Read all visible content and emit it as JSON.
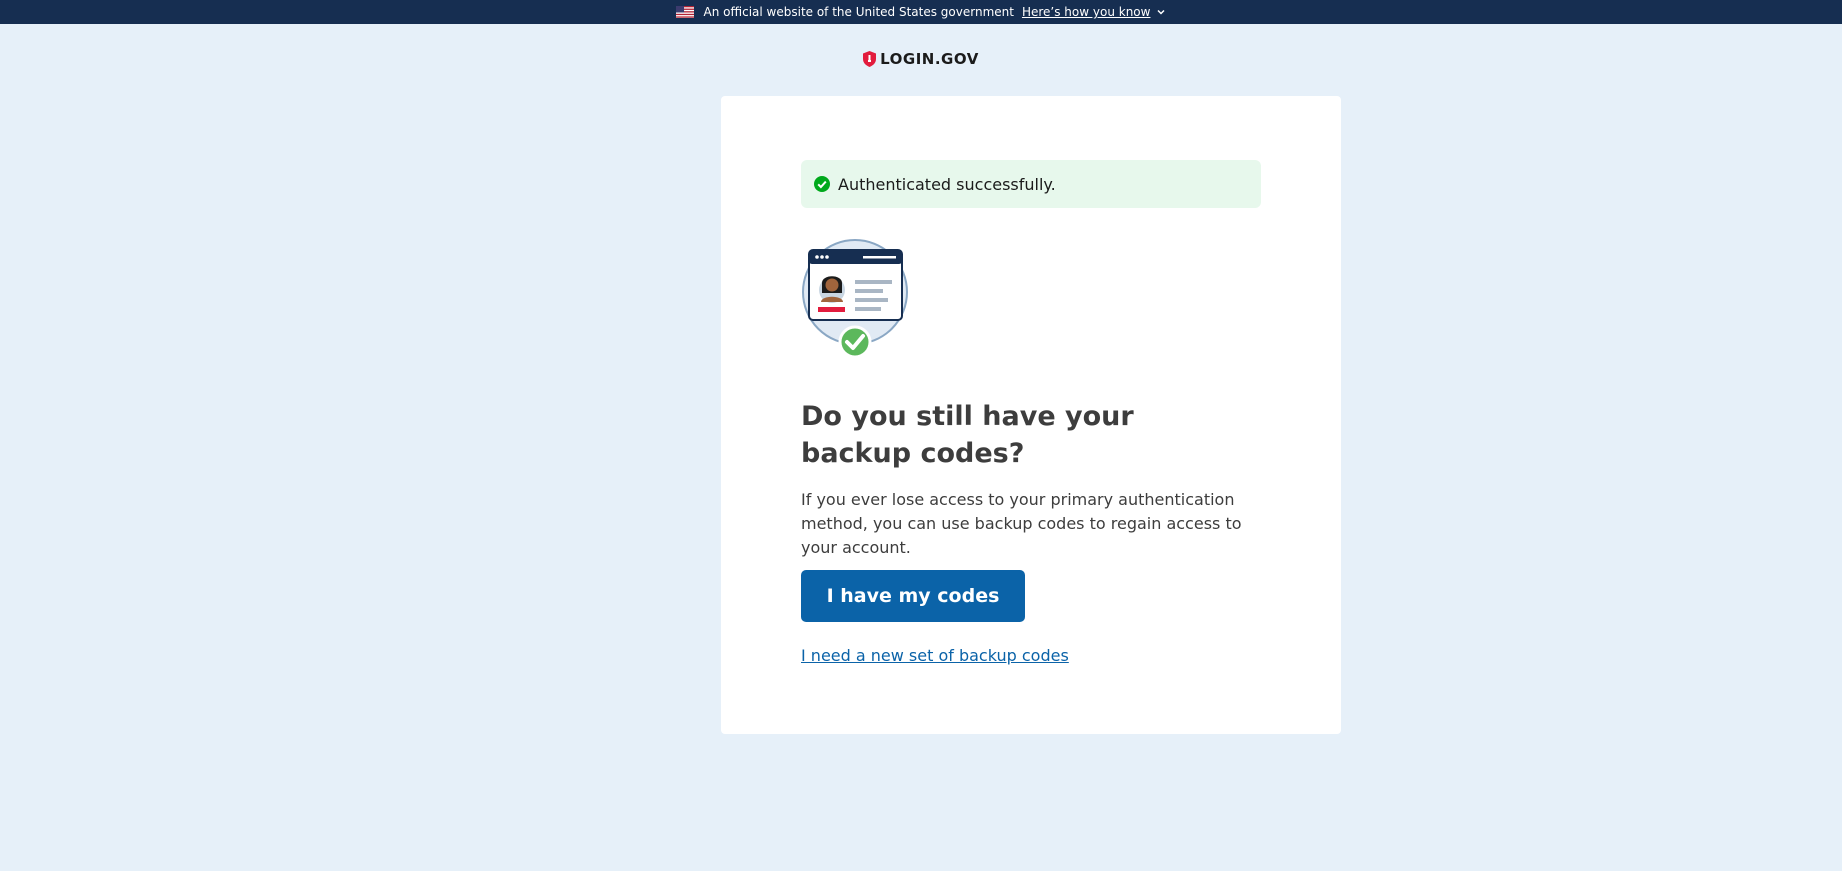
{
  "banner": {
    "text": "An official website of the United States government",
    "link_label": "Here’s how you know"
  },
  "header": {
    "logo_text": "LOGIN.GOV"
  },
  "alert": {
    "message": "Authenticated successfully."
  },
  "main": {
    "heading": "Do you still have your backup codes?",
    "description": "If you ever lose access to your primary authentication method, you can use backup codes to regain access to your account.",
    "primary_button": "I have my codes",
    "secondary_link": "I need a new set of backup codes"
  },
  "icons": {
    "flag": "us-flag-icon",
    "chevron": "chevron-down-icon",
    "logo": "shield-logo-icon",
    "alert": "check-circle-icon",
    "illustration": "id-card-check-illustration"
  },
  "colors": {
    "banner_bg": "#162e51",
    "page_bg": "#e6f0f9",
    "primary": "#0b63a8",
    "success_bg": "#e7f8ec",
    "success": "#00a91c"
  }
}
